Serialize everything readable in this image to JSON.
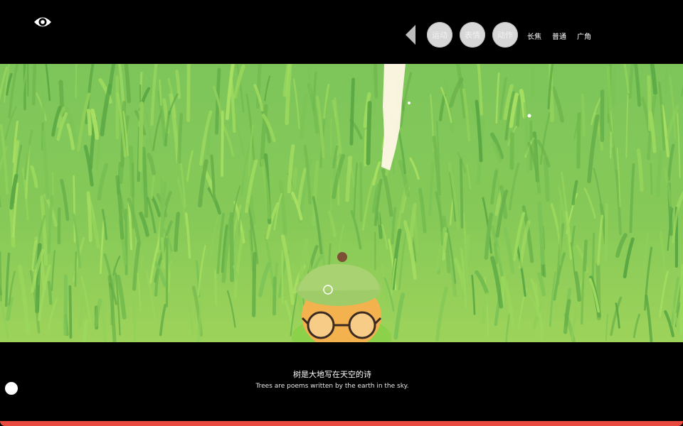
{
  "toolbar": {
    "buttons": [
      "运动",
      "表情",
      "动作"
    ],
    "lens_modes": [
      "长焦",
      "普通",
      "广角"
    ]
  },
  "subtitle": {
    "zh": "树是大地写在天空的诗",
    "en": "Trees are poems written by the earth in the sky."
  },
  "progress": {
    "value": 1.0
  },
  "colors": {
    "grass": "#8dcb5c",
    "progress": "#e94a3f"
  },
  "icons": {
    "eye": "eye-icon",
    "back": "back-arrow-icon"
  }
}
